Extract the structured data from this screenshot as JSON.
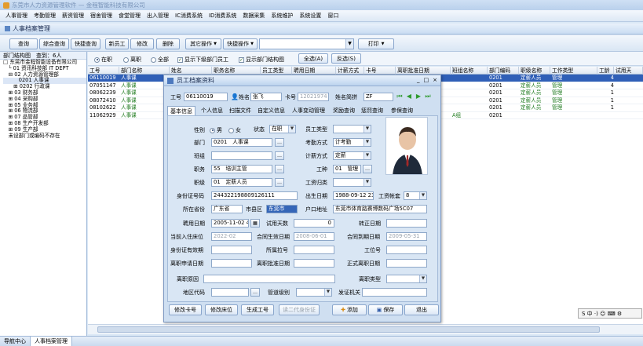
{
  "app_title": "东莞市人力资源管理软件 — 金程智能科技有限公司",
  "menu": [
    "人事管理",
    "考勤管理",
    "薪资管理",
    "宿舍管理",
    "食堂管理",
    "出入管理",
    "IC消费系统",
    "ID消费系统",
    "数据采集",
    "系统维护",
    "系统设置",
    "窗口"
  ],
  "module_tab": "人事档案管理",
  "toolbar": {
    "query": "查询",
    "combined_query": "综合查询",
    "quick_query": "快捷查询",
    "new_employee": "新员工",
    "edit": "修改",
    "delete": "删除",
    "other_ops": "其它操作",
    "quick_ops": "快捷操作",
    "search_value": "",
    "print": "打印"
  },
  "left": {
    "header": "部门结构图",
    "query_count": "查到：6人",
    "tree": [
      "□ 东莞市金程智能设备有限公司",
      "　└ 01 资讯科技部 IT DEPT",
      "　⊟ 02 人力资源管理部",
      "　　　0201 人事课",
      "　　⊞ 0202 行政课",
      "　⊞ 03 财务部",
      "　⊞ 04 采购部",
      "　⊞ 05 业务部",
      "　⊞ 06 物流部",
      "　⊞ 07 品管部",
      "　⊞ 08 生产开发部",
      "　⊞ 09 生产部",
      "　未设部门或编码不存在"
    ]
  },
  "filters": {
    "on_job": "在职",
    "resigned": "离职",
    "all": "全部",
    "show_sub": "显示下级部门员工",
    "show_struct": "显示部门结构图",
    "select_all": "全选(A)",
    "invert": "反选(S)"
  },
  "grid": {
    "headers": [
      "工号",
      "部门名称",
      "姓名",
      "职务名称",
      "员工类型",
      "聘用日期",
      "计薪方式",
      "卡号",
      "离职批准日期",
      "",
      "班组名称",
      "部门编码",
      "职级名称",
      "工作类型",
      "工龄",
      "试用天"
    ],
    "rows": [
      [
        "06110019",
        "人事课",
        "张飞",
        "培训主管",
        "",
        "",
        "",
        "",
        "",
        "",
        "",
        "0201",
        "定薪人员",
        "管理",
        "4",
        ""
      ],
      [
        "07051147",
        "人事课",
        "",
        "",
        "",
        "",
        "",
        "",
        "",
        "",
        "",
        "0201",
        "定薪人员",
        "管理",
        "4",
        ""
      ],
      [
        "08062239",
        "人事课",
        "",
        "",
        "",
        "",
        "",
        "",
        "",
        "",
        "",
        "0201",
        "定薪人员",
        "管理",
        "1",
        ""
      ],
      [
        "08072410",
        "人事课",
        "",
        "",
        "",
        "",
        "",
        "",
        "",
        "",
        "",
        "0201",
        "定薪人员",
        "管理",
        "1",
        ""
      ],
      [
        "08102622",
        "人事课",
        "",
        "",
        "",
        "",
        "",
        "",
        "",
        "",
        "",
        "0201",
        "定薪人员",
        "管理",
        "1",
        ""
      ],
      [
        "11062929",
        "人事课",
        "",
        "",
        "",
        "",
        "",
        "",
        "",
        "",
        "A组",
        "0201",
        "",
        "",
        "",
        ""
      ]
    ]
  },
  "status": {
    "nav_center": "导航中心",
    "active_tab": "人事档案管理"
  },
  "ime": "S 中 ·) ☺ ⌨ ⚙",
  "dialog": {
    "title": "员工档案资料",
    "emp_no_label": "工号",
    "emp_no": "06110019",
    "name_label": "姓名",
    "name": "张飞",
    "card_label": "卡号",
    "card": "12021974",
    "pinyin_label": "姓名简拼",
    "pinyin": "ZF",
    "tabs": [
      "基本信息",
      "个人信息",
      "扫描文件",
      "自定义信息",
      "人事变动管理",
      "奖励查询",
      "惩罚查询",
      "参保查询"
    ],
    "gender_label": "性别",
    "gender_m": "男",
    "gender_f": "女",
    "status_label": "状态",
    "status": "在职",
    "emptype_label": "员工类型",
    "emptype": "",
    "dept_label": "部门",
    "dept": "0201　人事课",
    "att_label": "考勤方式",
    "att": "计考勤",
    "team_label": "班组",
    "team": "",
    "pay_label": "计薪方式",
    "pay": "定薪",
    "post_label": "职务",
    "post": "55　培训主管",
    "worktype_label": "工种",
    "worktype": "01　管理",
    "grade_label": "职级",
    "grade": "01　定薪人员",
    "wagecat_label": "工资归类",
    "wagecat": "",
    "id_label": "身份证号码",
    "id": "244322198809126111",
    "birth_label": "出生日期",
    "birth": "1988-09-12 23",
    "senior_label": "工资帐套",
    "senior": "8",
    "prov_label": "所在省份",
    "prov": "广东省",
    "city_label": "市县区",
    "city": "东莞市",
    "addr_label": "户口地址",
    "addr": "东莞市体育路赛博数码广场5C07",
    "hire_label": "聘用日期",
    "hire": "2005-11-02 4",
    "trial_label": "试用天数",
    "trial": "0",
    "regular_label": "转正日期",
    "regular": "",
    "curlive_label": "当前入住床位",
    "curlive": "2022-02",
    "cstart_label": "合同生效日期",
    "cstart": "2008-06-01",
    "cend_label": "合同到期日期",
    "cend": "2009-05-31",
    "idexp_label": "身份证有效期",
    "idexp": "",
    "belong_label": "所属拉号",
    "belong": "",
    "station_label": "工位号",
    "station": "",
    "resapply_label": "离职申请日期",
    "resapply": "",
    "resapprove_label": "离职批准日期",
    "resapprove": "",
    "resformal_label": "正式离职日期",
    "resformal": "",
    "resreason_label": "离职原因",
    "resreason": "",
    "restype_label": "离职类型",
    "restype": "",
    "area_label": "地区代码",
    "area": "",
    "security_label": "管道级别",
    "security": "",
    "issue_label": "发证机关",
    "issue": "",
    "btn_card": "修改卡号",
    "btn_bed": "修改床位",
    "btn_genid": "生成工号",
    "btn_readid": "读二代身份证",
    "btn_add": "添加",
    "btn_save": "保存",
    "btn_exit": "退出"
  }
}
